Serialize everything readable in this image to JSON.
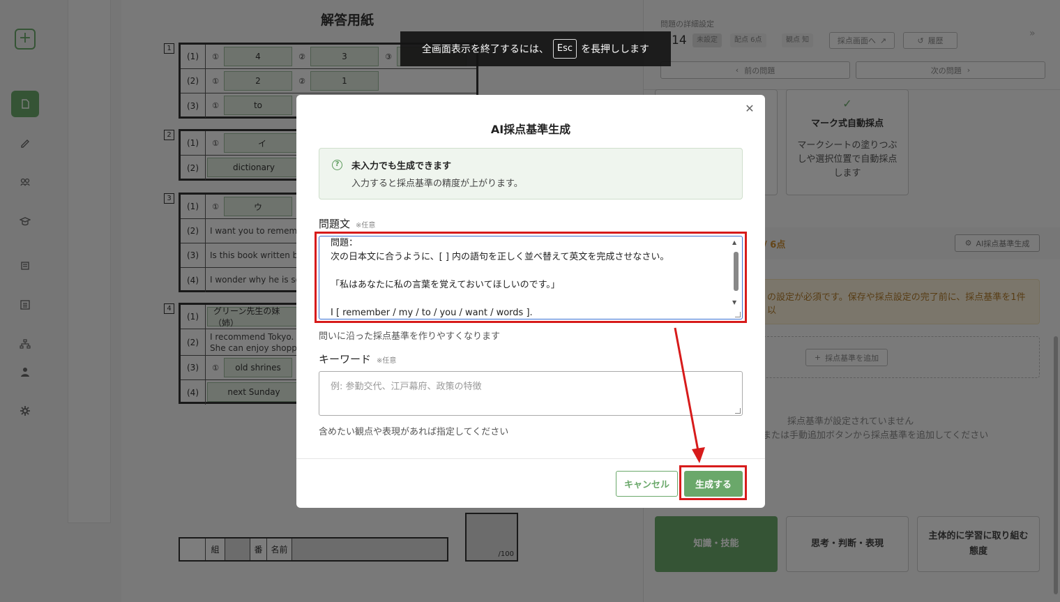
{
  "rail": {
    "items": [
      {
        "icon": "document-icon",
        "active": true
      },
      {
        "icon": "pen-icon"
      },
      {
        "icon": "group-icon"
      },
      {
        "icon": "graduation-cap-icon"
      },
      {
        "icon": "book-icon"
      },
      {
        "icon": "list-icon"
      },
      {
        "icon": "hierarchy-icon"
      },
      {
        "icon": "user-icon"
      },
      {
        "icon": "gear-icon"
      }
    ]
  },
  "sheet": {
    "title": "解答用紙",
    "q1": {
      "num": "1",
      "rows": [
        {
          "label": "(1)",
          "c1": "①",
          "a1": "4",
          "c2": "②",
          "a2": "3",
          "c3": "③"
        },
        {
          "label": "(2)",
          "c1": "①",
          "a1": "2",
          "c2": "②",
          "a2": "1"
        },
        {
          "label": "(3)",
          "c1": "①",
          "a1": "to"
        }
      ]
    },
    "q2": {
      "num": "2",
      "rows": [
        {
          "label": "(1)",
          "c1": "①",
          "a1": "イ"
        },
        {
          "label": "(2)",
          "a1": "dictionary"
        }
      ]
    },
    "q3": {
      "num": "3",
      "rows": [
        {
          "label": "(1)",
          "c1": "①",
          "a1": "ウ"
        },
        {
          "label": "(2)",
          "a1": "I want you to rememb"
        },
        {
          "label": "(3)",
          "a1": "Is this book written by"
        },
        {
          "label": "(4)",
          "a1": "I wonder why he is so"
        }
      ]
    },
    "q4": {
      "num": "4",
      "rows": [
        {
          "label": "(1)",
          "a1": "グリーン先生の妹（姉）"
        },
        {
          "label": "(2)",
          "a1": "I recommend Tokyo.",
          "a1b": "She can enjoy shoppi"
        },
        {
          "label": "(3)",
          "c1": "①",
          "a1": "old shrines"
        },
        {
          "label": "(4)",
          "a1": "next Sunday"
        }
      ]
    },
    "footer": {
      "class_label": "組",
      "number_label": "番",
      "name_label": "名前",
      "score_total": "/100"
    }
  },
  "rpanel": {
    "title": "問題の詳細設定",
    "qnum": "14",
    "tag_status": "未設定",
    "tag_points": "配点 6点",
    "tag_view": "観点 知",
    "btn_grading": "採点画面へ",
    "btn_history": "履歴",
    "prev": "前の問題",
    "next": "次の問題",
    "mark_card_title": "マーク式自動採点",
    "mark_card_desc": "マークシートの塗りつぶしや選択位置で自動採点します",
    "score": "/ 6点",
    "ai_btn": "AI採点基準生成",
    "warn": "の設定が必須です。保存や採点設定の完了前に、採点基準を1件以",
    "add_btn": "採点基準を追加",
    "empty1": "採点基準が設定されていません",
    "empty2": "または手動追加ボタンから採点基準を追加してください",
    "cat1": "知識・技能",
    "cat2": "思考・判断・表現",
    "cat3": "主体的に学習に取り組む態度"
  },
  "toast": {
    "before": "全画面表示を終了するには、",
    "key": "Esc",
    "after": "を長押しします"
  },
  "modal": {
    "title": "AI採点基準生成",
    "info_title": "未入力でも生成できます",
    "info_body": "入力すると採点基準の精度が上がります。",
    "question_label": "問題文",
    "optional": "※任意",
    "question_lines": [
      "問題：",
      "次の日本文に合うように、[ ] 内の語句を正しく並べ替えて英文を完成させなさい。",
      "",
      "「私はあなたに私の言葉を覚えておいてほしいのです。」",
      "",
      "I [ remember / my / to / you / want / words ]."
    ],
    "question_hint": "問いに沿った採点基準を作りやすくなります",
    "keyword_label": "キーワード",
    "keyword_placeholder": "例: 参勤交代、江戸幕府、政策の特徴",
    "keyword_value": "",
    "keyword_hint": "含めたい観点や表現があれば指定してください",
    "cancel": "キャンセル",
    "generate": "生成する"
  },
  "colors": {
    "accent": "#6aa86a",
    "highlight": "#d71b1b",
    "warning": "#b07a2a"
  }
}
